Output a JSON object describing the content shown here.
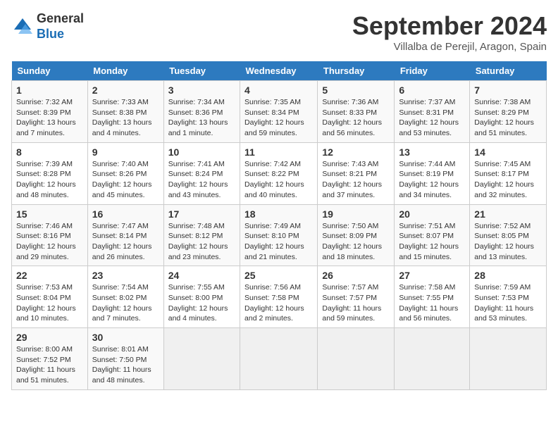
{
  "header": {
    "logo_general": "General",
    "logo_blue": "Blue",
    "month_title": "September 2024",
    "location": "Villalba de Perejil, Aragon, Spain"
  },
  "columns": [
    "Sunday",
    "Monday",
    "Tuesday",
    "Wednesday",
    "Thursday",
    "Friday",
    "Saturday"
  ],
  "weeks": [
    [
      {
        "day": "1",
        "info": "Sunrise: 7:32 AM\nSunset: 8:39 PM\nDaylight: 13 hours\nand 7 minutes."
      },
      {
        "day": "2",
        "info": "Sunrise: 7:33 AM\nSunset: 8:38 PM\nDaylight: 13 hours\nand 4 minutes."
      },
      {
        "day": "3",
        "info": "Sunrise: 7:34 AM\nSunset: 8:36 PM\nDaylight: 13 hours\nand 1 minute."
      },
      {
        "day": "4",
        "info": "Sunrise: 7:35 AM\nSunset: 8:34 PM\nDaylight: 12 hours\nand 59 minutes."
      },
      {
        "day": "5",
        "info": "Sunrise: 7:36 AM\nSunset: 8:33 PM\nDaylight: 12 hours\nand 56 minutes."
      },
      {
        "day": "6",
        "info": "Sunrise: 7:37 AM\nSunset: 8:31 PM\nDaylight: 12 hours\nand 53 minutes."
      },
      {
        "day": "7",
        "info": "Sunrise: 7:38 AM\nSunset: 8:29 PM\nDaylight: 12 hours\nand 51 minutes."
      }
    ],
    [
      {
        "day": "8",
        "info": "Sunrise: 7:39 AM\nSunset: 8:28 PM\nDaylight: 12 hours\nand 48 minutes."
      },
      {
        "day": "9",
        "info": "Sunrise: 7:40 AM\nSunset: 8:26 PM\nDaylight: 12 hours\nand 45 minutes."
      },
      {
        "day": "10",
        "info": "Sunrise: 7:41 AM\nSunset: 8:24 PM\nDaylight: 12 hours\nand 43 minutes."
      },
      {
        "day": "11",
        "info": "Sunrise: 7:42 AM\nSunset: 8:22 PM\nDaylight: 12 hours\nand 40 minutes."
      },
      {
        "day": "12",
        "info": "Sunrise: 7:43 AM\nSunset: 8:21 PM\nDaylight: 12 hours\nand 37 minutes."
      },
      {
        "day": "13",
        "info": "Sunrise: 7:44 AM\nSunset: 8:19 PM\nDaylight: 12 hours\nand 34 minutes."
      },
      {
        "day": "14",
        "info": "Sunrise: 7:45 AM\nSunset: 8:17 PM\nDaylight: 12 hours\nand 32 minutes."
      }
    ],
    [
      {
        "day": "15",
        "info": "Sunrise: 7:46 AM\nSunset: 8:16 PM\nDaylight: 12 hours\nand 29 minutes."
      },
      {
        "day": "16",
        "info": "Sunrise: 7:47 AM\nSunset: 8:14 PM\nDaylight: 12 hours\nand 26 minutes."
      },
      {
        "day": "17",
        "info": "Sunrise: 7:48 AM\nSunset: 8:12 PM\nDaylight: 12 hours\nand 23 minutes."
      },
      {
        "day": "18",
        "info": "Sunrise: 7:49 AM\nSunset: 8:10 PM\nDaylight: 12 hours\nand 21 minutes."
      },
      {
        "day": "19",
        "info": "Sunrise: 7:50 AM\nSunset: 8:09 PM\nDaylight: 12 hours\nand 18 minutes."
      },
      {
        "day": "20",
        "info": "Sunrise: 7:51 AM\nSunset: 8:07 PM\nDaylight: 12 hours\nand 15 minutes."
      },
      {
        "day": "21",
        "info": "Sunrise: 7:52 AM\nSunset: 8:05 PM\nDaylight: 12 hours\nand 13 minutes."
      }
    ],
    [
      {
        "day": "22",
        "info": "Sunrise: 7:53 AM\nSunset: 8:04 PM\nDaylight: 12 hours\nand 10 minutes."
      },
      {
        "day": "23",
        "info": "Sunrise: 7:54 AM\nSunset: 8:02 PM\nDaylight: 12 hours\nand 7 minutes."
      },
      {
        "day": "24",
        "info": "Sunrise: 7:55 AM\nSunset: 8:00 PM\nDaylight: 12 hours\nand 4 minutes."
      },
      {
        "day": "25",
        "info": "Sunrise: 7:56 AM\nSunset: 7:58 PM\nDaylight: 12 hours\nand 2 minutes."
      },
      {
        "day": "26",
        "info": "Sunrise: 7:57 AM\nSunset: 7:57 PM\nDaylight: 11 hours\nand 59 minutes."
      },
      {
        "day": "27",
        "info": "Sunrise: 7:58 AM\nSunset: 7:55 PM\nDaylight: 11 hours\nand 56 minutes."
      },
      {
        "day": "28",
        "info": "Sunrise: 7:59 AM\nSunset: 7:53 PM\nDaylight: 11 hours\nand 53 minutes."
      }
    ],
    [
      {
        "day": "29",
        "info": "Sunrise: 8:00 AM\nSunset: 7:52 PM\nDaylight: 11 hours\nand 51 minutes."
      },
      {
        "day": "30",
        "info": "Sunrise: 8:01 AM\nSunset: 7:50 PM\nDaylight: 11 hours\nand 48 minutes."
      },
      null,
      null,
      null,
      null,
      null
    ]
  ]
}
